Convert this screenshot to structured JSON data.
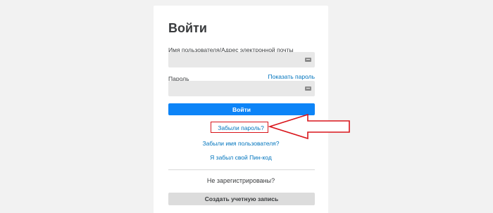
{
  "login": {
    "title": "Войти",
    "username_label": "Имя пользователя/Адрес электронной почты",
    "username_value": "",
    "password_label": "Пароль",
    "password_value": "",
    "show_password_label": "Показать пароль",
    "login_button_label": "Войти",
    "forgot_password_label": "Забыли пароль?",
    "forgot_username_label": "Забыли имя пользователя?",
    "forgot_pin_label": "Я забыл свой Пин-код",
    "not_registered_text": "Не зарегистрированы?",
    "create_account_label": "Создать учетную запись"
  },
  "icons": {
    "field_key_icon": "keyboard-icon",
    "annotation": "arrow-pointer-icon"
  },
  "colors": {
    "accent": "#0d84f7",
    "link": "#0074bd",
    "annotation": "#d9151b",
    "background": "#f2f2f2",
    "input_background": "#e8e8e8",
    "secondary_button": "#dcdcdc",
    "text": "#393b3d"
  }
}
